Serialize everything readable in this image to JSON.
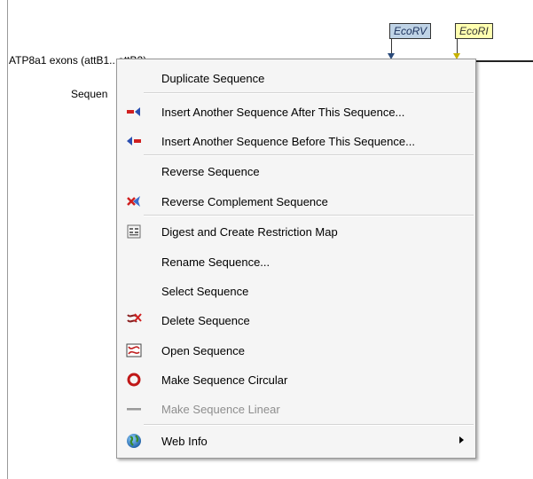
{
  "background": {
    "sequence_title": "ATP8a1 exons (attB1...attB2)",
    "sequence_label_partial": "Sequen"
  },
  "enzymes": [
    {
      "name": "EcoRV",
      "color": "#bfd3e6"
    },
    {
      "name": "EcoRI",
      "color": "#ffffb0"
    }
  ],
  "menu": {
    "items": [
      {
        "label": "Duplicate Sequence",
        "icon": "none"
      },
      {
        "label": "Insert Another Sequence After This Sequence...",
        "icon": "insert-after-icon"
      },
      {
        "label": "Insert Another Sequence Before This Sequence...",
        "icon": "insert-before-icon"
      },
      {
        "label": "Reverse Sequence",
        "icon": "none"
      },
      {
        "label": "Reverse Complement Sequence",
        "icon": "reverse-complement-icon"
      },
      {
        "label": "Digest and Create Restriction Map",
        "icon": "digest-icon"
      },
      {
        "label": "Rename Sequence...",
        "icon": "none"
      },
      {
        "label": "Select Sequence",
        "icon": "none"
      },
      {
        "label": "Delete Sequence",
        "icon": "delete-icon"
      },
      {
        "label": "Open Sequence",
        "icon": "open-sequence-icon"
      },
      {
        "label": "Make Sequence Circular",
        "icon": "circular-icon"
      },
      {
        "label": "Make Sequence Linear",
        "icon": "linear-icon",
        "disabled": true
      },
      {
        "label": "Web Info",
        "icon": "globe-icon",
        "submenu": true
      }
    ]
  }
}
